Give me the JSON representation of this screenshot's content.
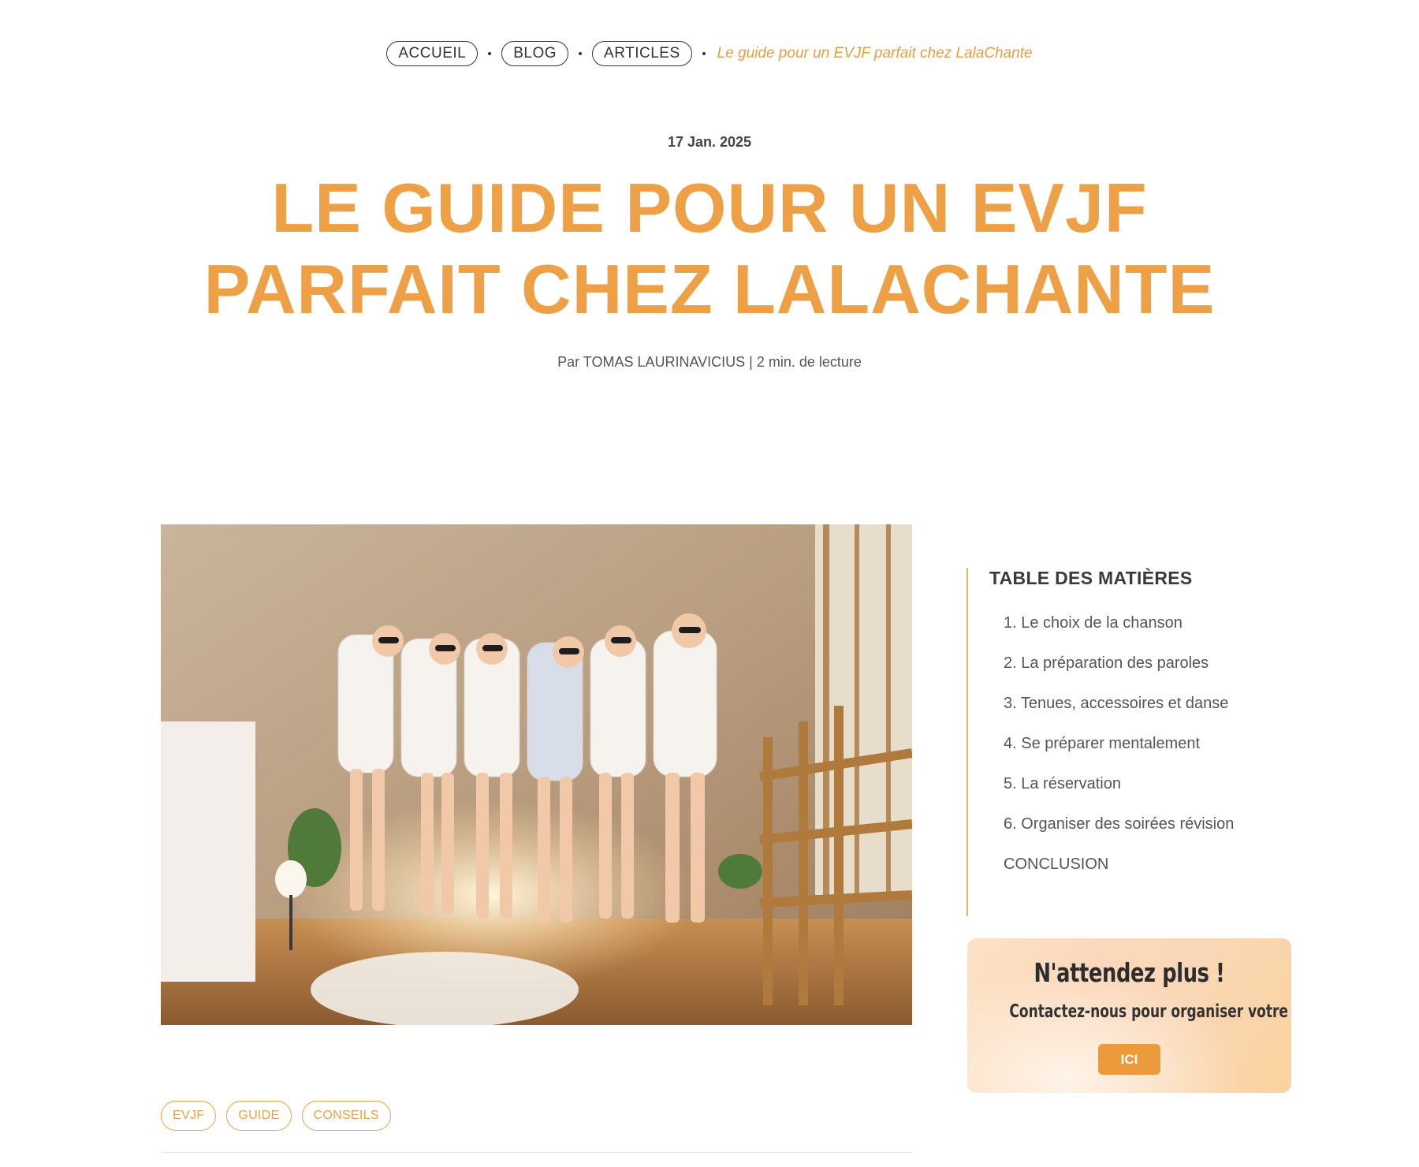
{
  "breadcrumb": {
    "items": [
      "ACCUEIL",
      "BLOG",
      "ARTICLES"
    ],
    "current": "Le guide pour un EVJF parfait chez LalaChante"
  },
  "article": {
    "date": "17 Jan. 2025",
    "title_line1": "LE GUIDE POUR UN EVJF",
    "title_line2": "PARFAIT CHEZ LALACHANTE",
    "byline": "Par TOMAS LAURINAVICIUS | 2 min. de lecture",
    "tags": [
      "EVJF",
      "GUIDE",
      "CONSEILS"
    ]
  },
  "toc": {
    "title": "TABLE DES MATIÈRES",
    "items": [
      "1. Le choix de la chanson",
      "2. La préparation des paroles",
      "3. Tenues, accessoires et danse",
      "4. Se préparer mentalement",
      "5. La réservation",
      "6. Organiser des soirées révision",
      "CONCLUSION"
    ]
  },
  "cta": {
    "heading": "N'attendez plus !",
    "subheading": "Contactez-nous pour organiser votre EVJF",
    "button": "ICI"
  },
  "colors": {
    "accent": "#eda045",
    "text": "#3f3f3f"
  }
}
